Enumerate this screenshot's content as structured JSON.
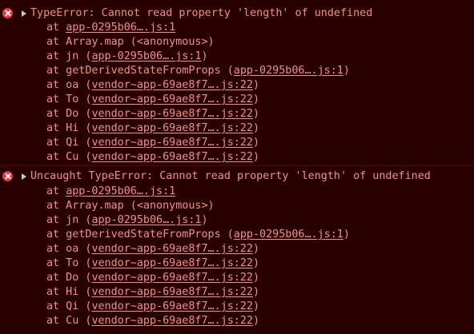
{
  "errors": [
    {
      "message": "TypeError: Cannot read property 'length' of undefined",
      "frames": [
        {
          "prefix": "at ",
          "link": "app-0295b06….js:1",
          "suffix": ""
        },
        {
          "prefix": "at Array.map (<anonymous>)",
          "link": "",
          "suffix": ""
        },
        {
          "prefix": "at jn (",
          "link": "app-0295b06….js:1",
          "suffix": ")"
        },
        {
          "prefix": "at getDerivedStateFromProps (",
          "link": "app-0295b06….js:1",
          "suffix": ")"
        },
        {
          "prefix": "at oa (",
          "link": "vendor~app-69ae8f7….js:22",
          "suffix": ")"
        },
        {
          "prefix": "at To (",
          "link": "vendor~app-69ae8f7….js:22",
          "suffix": ")"
        },
        {
          "prefix": "at Do (",
          "link": "vendor~app-69ae8f7….js:22",
          "suffix": ")"
        },
        {
          "prefix": "at Hi (",
          "link": "vendor~app-69ae8f7….js:22",
          "suffix": ")"
        },
        {
          "prefix": "at Qi (",
          "link": "vendor~app-69ae8f7….js:22",
          "suffix": ")"
        },
        {
          "prefix": "at Cu (",
          "link": "vendor~app-69ae8f7….js:22",
          "suffix": ")"
        }
      ]
    },
    {
      "message": "Uncaught TypeError: Cannot read property 'length' of undefined",
      "frames": [
        {
          "prefix": "at ",
          "link": "app-0295b06….js:1",
          "suffix": ""
        },
        {
          "prefix": "at Array.map (<anonymous>)",
          "link": "",
          "suffix": ""
        },
        {
          "prefix": "at jn (",
          "link": "app-0295b06….js:1",
          "suffix": ")"
        },
        {
          "prefix": "at getDerivedStateFromProps (",
          "link": "app-0295b06….js:1",
          "suffix": ")"
        },
        {
          "prefix": "at oa (",
          "link": "vendor~app-69ae8f7….js:22",
          "suffix": ")"
        },
        {
          "prefix": "at To (",
          "link": "vendor~app-69ae8f7….js:22",
          "suffix": ")"
        },
        {
          "prefix": "at Do (",
          "link": "vendor~app-69ae8f7….js:22",
          "suffix": ")"
        },
        {
          "prefix": "at Hi (",
          "link": "vendor~app-69ae8f7….js:22",
          "suffix": ")"
        },
        {
          "prefix": "at Qi (",
          "link": "vendor~app-69ae8f7….js:22",
          "suffix": ")"
        },
        {
          "prefix": "at Cu (",
          "link": "vendor~app-69ae8f7….js:22",
          "suffix": ")"
        }
      ]
    }
  ],
  "icons": {
    "error": "error-icon",
    "expand": "expand-caret-icon"
  },
  "colors": {
    "background": "#290000",
    "text": "#f0908e",
    "error_icon": "#e8383a",
    "divider": "#5c0000"
  }
}
